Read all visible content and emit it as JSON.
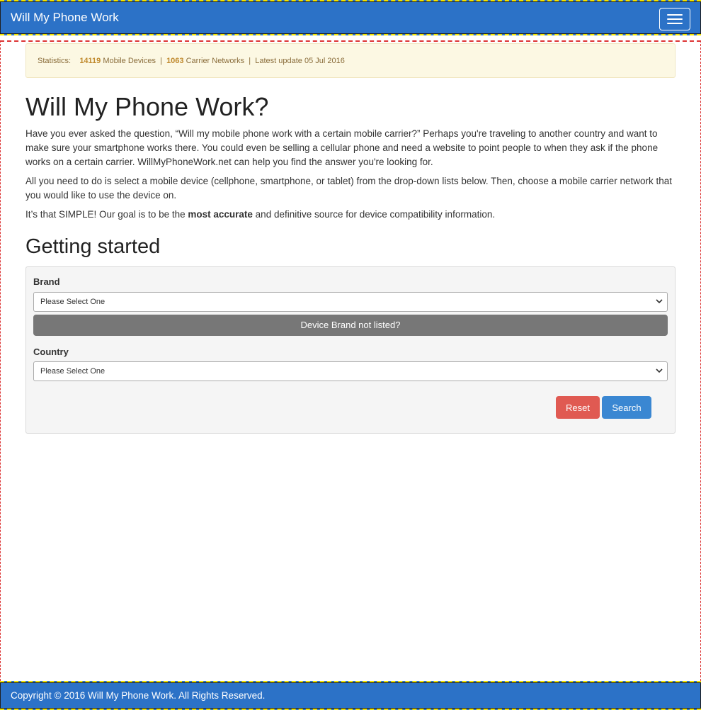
{
  "navbar": {
    "brand": "Will My Phone Work",
    "menu_icon": "hamburger-menu-icon"
  },
  "stats": {
    "label": "Statistics:",
    "devices_count": "14119",
    "devices_label": "Mobile Devices",
    "separator": "|",
    "carriers_count": "1063",
    "carriers_label": "Carrier Networks",
    "update_text": "Latest update 05 Jul 2016"
  },
  "main": {
    "title": "Will My Phone Work?",
    "para1": "Have you ever asked the question, “Will my mobile phone work with a certain mobile carrier?” Perhaps you're traveling to another country and want to make sure your smartphone works there. You could even be selling a cellular phone and need a website to point people to when they ask if the phone works on a certain carrier. WillMyPhoneWork.net can help you find the answer you're looking for.",
    "para2": "All you need to do is select a mobile device (cellphone, smartphone, or tablet) from the drop-down lists below. Then, choose a mobile carrier network that you would like to use the device on.",
    "para3_pre": "It’s that SIMPLE! Our goal is to be the ",
    "para3_bold": "most accurate",
    "para3_post": " and definitive source for device compatibility information.",
    "section_title": "Getting started"
  },
  "form": {
    "brand_label": "Brand",
    "brand_value": "Please Select One",
    "brand_not_listed": "Device Brand not listed?",
    "country_label": "Country",
    "country_value": "Please Select One",
    "reset_label": "Reset",
    "search_label": "Search"
  },
  "footer": {
    "copyright": "Copyright © 2016 Will My Phone Work. All Rights Reserved."
  },
  "colors": {
    "navbar_bg": "#2c72c7",
    "accent_dash": "#f2e400",
    "reset_bg": "#e05a52",
    "search_bg": "#3a87d2"
  }
}
